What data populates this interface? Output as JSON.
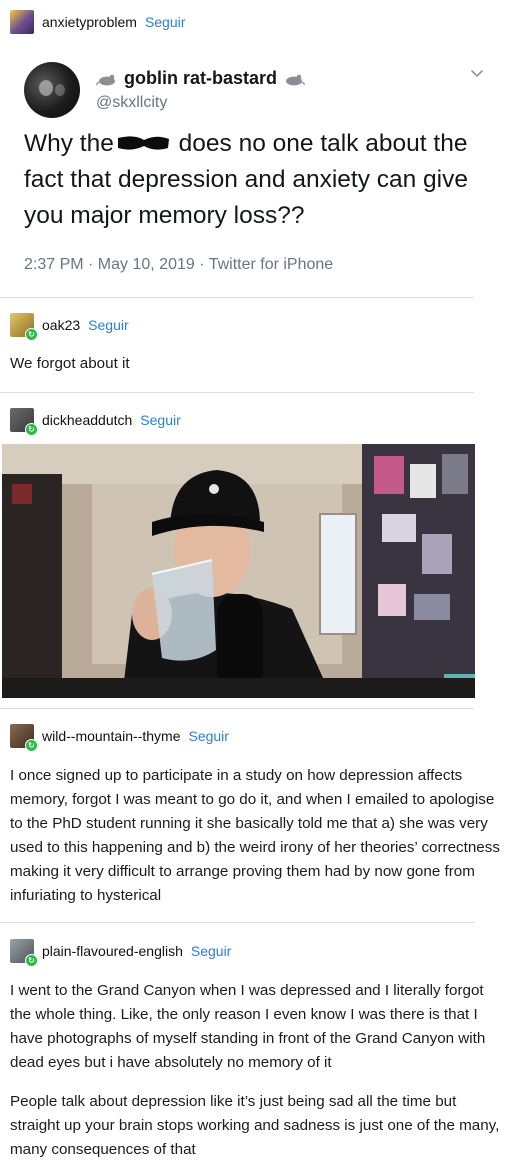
{
  "posts": [
    {
      "username": "anxietyproblem",
      "follow": "Seguir"
    },
    {
      "username": "oak23",
      "follow": "Seguir",
      "text": "We forgot about it"
    },
    {
      "username": "dickheaddutch",
      "follow": "Seguir"
    },
    {
      "username": "wild--mountain--thyme",
      "follow": "Seguir",
      "text": "I once signed up to participate in a study on how depression affects memory, forgot I was meant to go do it, and when I emailed to apologise to the PhD student running it she basically told me that a) she was very used to this happening and b) the weird irony of her theories’ correctness making it very difficult to arrange proving them had by now gone from infuriating to hysterical"
    },
    {
      "username": "plain-flavoured-english",
      "follow": "Seguir",
      "paragraphs": [
        "I went to the Grand Canyon when I was depressed and I literally forgot the whole thing. Like, the only reason I even know I was there is that I have photographs of myself standing in front of the Grand Canyon with dead eyes but i have absolutely no memory of it",
        "People talk about depression like it’s just being sad all the time but straight up your brain stops working and sadness is just one of the many, many consequences of that"
      ]
    }
  ],
  "tweet": {
    "display_name": "goblin rat-bastard",
    "handle": "@skxllcity",
    "text_before": "Why the",
    "text_after": " does no one talk about the fact that depression and anxiety can give you major memory loss??",
    "meta": "2:37 PM · May 10, 2019 · Twitter for iPhone"
  }
}
